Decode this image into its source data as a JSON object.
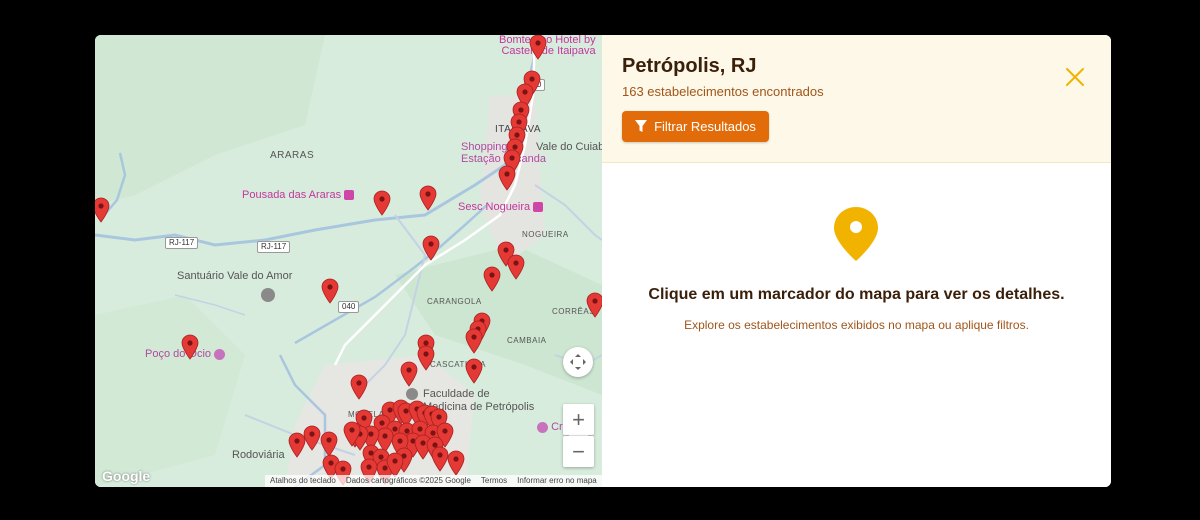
{
  "map": {
    "labels": {
      "araras": "ARARAS",
      "itaipava": "ITAIPAVA",
      "nogueira": "NOGUEIRA",
      "carangola": "CARANGOLA",
      "correas": "CORRÊAS",
      "cascatinha": "CASCATINHA",
      "moselas": "MOSELA",
      "cambaia": "CAMBAIA",
      "pousada": "Pousada das Araras",
      "santuario": "Santuário Vale do Amor",
      "poco": "Poço do Ocio",
      "bomtempo_1": "Bomtempo Hotel by",
      "bomtempo_2": "Castelo de Itaipava",
      "shopping": "Shopping",
      "estacao": "Estação Locanda",
      "vale_cuiaba": "Vale do Cuiabá",
      "sesc": "Sesc Nogueira",
      "faculdade_1": "Faculdade de",
      "faculdade_2": "Medicina de Petrópolis",
      "rodoviaria": "Rodoviária",
      "crystal": "Cristal"
    },
    "shields": {
      "rj117_a": "RJ-117",
      "rj117_b": "RJ-117",
      "br040": "040",
      "br040_top": "040"
    },
    "google_logo": "Google",
    "attribution": {
      "shortcuts": "Atalhos do teclado",
      "data": "Dados cartográficos ©2025 Google",
      "terms": "Termos",
      "report": "Informar erro no mapa"
    },
    "controls": {
      "fullscreen_icon": "expand-arrows-icon",
      "zoom_in": "+",
      "zoom_out": "−"
    },
    "marker_color": "#e53935"
  },
  "panel": {
    "title": "Petrópolis, RJ",
    "count": "163 estabelecimentos encontrados",
    "filter_label": "Filtrar Resultados",
    "empty_title": "Clique em um marcador do mapa para ver os detalhes.",
    "empty_sub": "Explore os estabelecimentos exibidos no mapa ou aplique filtros.",
    "accent": "#e36c0a",
    "icon_color": "#f2b300"
  }
}
